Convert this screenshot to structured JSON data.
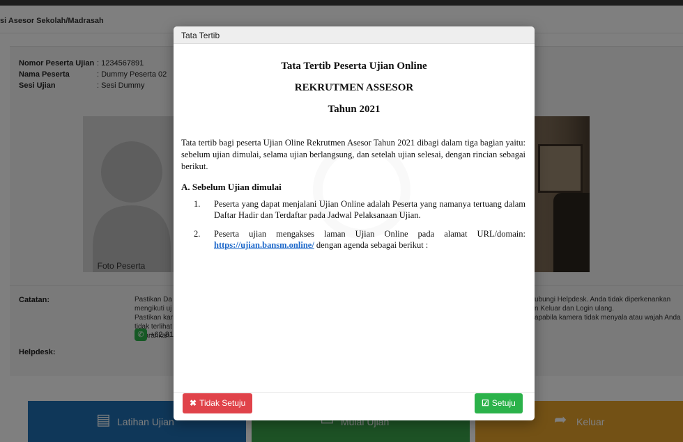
{
  "page": {
    "header_title": "si Asesor Sekolah/Madrasah",
    "participant": {
      "nomor_label": "Nomor Peserta Ujian",
      "nomor_value": ": 1234567891",
      "nama_label": "Nama Peserta",
      "nama_value": ": Dummy Peserta 02",
      "sesi_label": "Sesi Ujian",
      "sesi_value": ": Sesi Dummy"
    },
    "photo_caption": "Foto Peserta",
    "catatan_label": "Catatan:",
    "catatan_left": [
      "Pastikan Da",
      "mengikuti uj",
      "Pastikan kar",
      "tidak terlihat",
      "Disarankan"
    ],
    "catatan_right": [
      "ubungi Helpdesk. Anda tidak diperkenankan",
      "n Keluar dan Login ulang.",
      "apabila kamera tidak menyala atau wajah Anda"
    ],
    "helpdesk_label": "Helpdesk:",
    "helpdesk_value": "+62 81",
    "buttons": {
      "latihan": "Latihan Ujian",
      "mulai": "Mulai Ujian",
      "keluar": "Keluar"
    },
    "colors": {
      "latihan": "#1f6fb2",
      "mulai": "#3aa54a",
      "keluar": "#e6a22a"
    }
  },
  "modal": {
    "header_title": "Tata Tertib",
    "title_line1": "Tata Tertib Peserta Ujian Online",
    "title_line2": "REKRUTMEN ASSESOR",
    "title_line3": "Tahun 2021",
    "intro": "Tata tertib bagi peserta Ujian Oline Rekrutmen Asesor Tahun 2021 dibagi dalam tiga bagian yaitu: sebelum ujian dimulai, selama ujian berlangsung, dan setelah ujian selesai, dengan rincian sebagai berikut.",
    "section_a": "A. Sebelum Ujian dimulai",
    "items": [
      {
        "num": "1.",
        "text": "Peserta yang dapat menjalani Ujian Online adalah Peserta yang namanya tertuang dalam Daftar Hadir dan Terdaftar pada Jadwal Pelaksanaan Ujian."
      },
      {
        "num": "2.",
        "text_before": "Peserta ujian mengakses laman Ujian Online pada alamat URL/domain: ",
        "link": "https://ujian.bansm.online/",
        "text_after": " dengan agenda sebagai berikut :"
      }
    ],
    "reject_label": "Tidak Setuju",
    "accept_label": "Setuju",
    "colors": {
      "reject": "#e0434a",
      "accept": "#2bb24a"
    }
  }
}
